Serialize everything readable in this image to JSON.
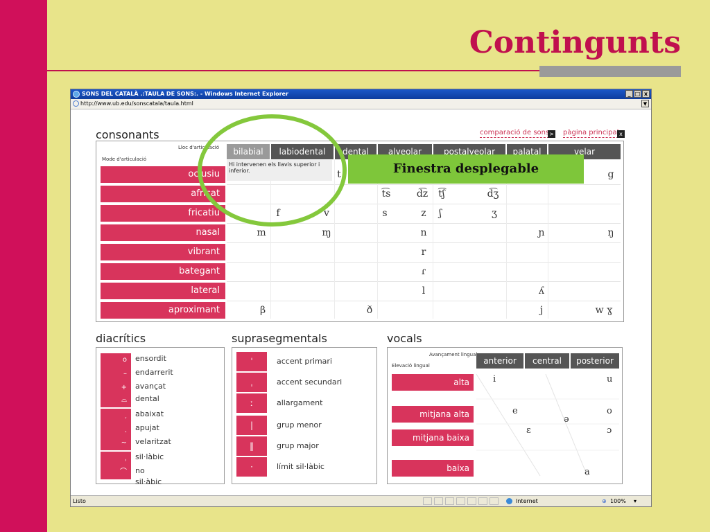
{
  "slide": {
    "title": "Contingunts"
  },
  "browser": {
    "title": "SONS DEL CATALÀ .:TAULA DE SONS:. - Windows Internet Explorer",
    "address": "http://www.ub.edu/sonscatala/taula.html",
    "window_buttons": [
      "_",
      "□",
      "x"
    ],
    "status_left": "Listo",
    "status_zone": "Internet",
    "zoom": "100%"
  },
  "page": {
    "consonants_title": "consonants",
    "link_compare": "comparació de sons",
    "link_main": "pàgina principal",
    "axis_place": "Lloc d'articulació",
    "axis_mode": "Mode d'articulació",
    "columns": [
      "bilabial",
      "labiodental",
      "dental",
      "alveolar",
      "postalveolar",
      "palatal",
      "velar"
    ],
    "rows": [
      "oclusiu",
      "africat",
      "fricatiu",
      "nasal",
      "vibrant",
      "bategant",
      "lateral",
      "aproximant"
    ],
    "tooltip": "Hi intervenen els llavis superior i inferior.",
    "callout": "Finestra desplegable",
    "symbols": {
      "dental_t": "t",
      "velar_g": "g",
      "ts": "t͡s",
      "dz": "d͡z",
      "tsh": "t͡ʃ",
      "dzh": "d͡ʒ",
      "f": "f",
      "v": "v",
      "s": "s",
      "z": "z",
      "sh": "ʃ",
      "zh": "ʒ",
      "m": "m",
      "mj": "ɱ",
      "n": "n",
      "nj": "ɲ",
      "ng": "ŋ",
      "r": "r",
      "tap": "ɾ",
      "l": "l",
      "ll": "ʎ",
      "beta": "β",
      "eth": "ð",
      "j": "j",
      "wg": "w ɣ"
    },
    "diacritics_title": "diacrítics",
    "diacritics": [
      {
        "mark": "o",
        "label": "ensordit"
      },
      {
        "mark": "–",
        "label": "endarrerit"
      },
      {
        "mark": "+",
        "label": "avançat"
      },
      {
        "mark": "⌓",
        "label": "dental"
      },
      {
        "mark": "˯",
        "label": "abaixat"
      },
      {
        "mark": "˰",
        "label": "apujat"
      },
      {
        "mark": "~",
        "label": "velaritzat"
      },
      {
        "mark": "ˌ",
        "label": "sil·làbic"
      },
      {
        "mark": "⌒",
        "label": "no sil·àbic"
      }
    ],
    "supra_title": "suprasegmentals",
    "suprasegmentals": [
      {
        "mark": "ˈ",
        "label": "accent primari"
      },
      {
        "mark": "ˌ",
        "label": "accent secundari"
      },
      {
        "mark": "ː",
        "label": "allargament"
      },
      {
        "mark": "|",
        "label": "grup menor"
      },
      {
        "mark": "‖",
        "label": "grup major"
      },
      {
        "mark": "·",
        "label": "límit sil·làbic"
      }
    ],
    "vowels_title": "vocals",
    "vowel_axis_front": "Avançament lingual",
    "vowel_axis_height": "Elevació lingual",
    "vowel_columns": [
      "anterior",
      "central",
      "posterior"
    ],
    "vowel_rows": [
      "alta",
      "mitjana alta",
      "mitjana baixa",
      "baixa"
    ],
    "vowel_symbols": {
      "i": "i",
      "u": "u",
      "e": "e",
      "schwa": "ə",
      "o": "o",
      "eps": "ɛ",
      "openo": "ɔ",
      "a": "a"
    }
  }
}
